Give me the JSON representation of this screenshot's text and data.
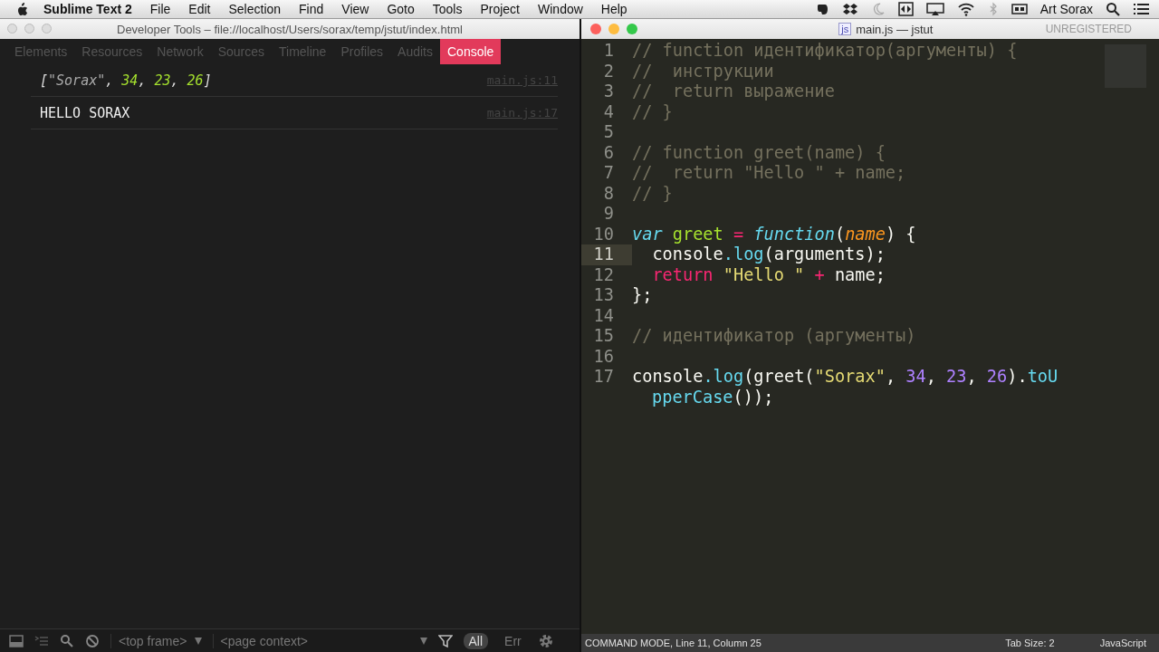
{
  "menubar": {
    "app": "Sublime Text 2",
    "items": [
      "File",
      "Edit",
      "Selection",
      "Find",
      "View",
      "Goto",
      "Tools",
      "Project",
      "Window",
      "Help"
    ],
    "user": "Art Sorax"
  },
  "devtools": {
    "title": "Developer Tools – file://localhost/Users/sorax/temp/jstut/index.html",
    "tabs": [
      {
        "label": "Elements",
        "selected": false
      },
      {
        "label": "Resources",
        "selected": false
      },
      {
        "label": "Network",
        "selected": false
      },
      {
        "label": "Sources",
        "selected": false
      },
      {
        "label": "Timeline",
        "selected": false
      },
      {
        "label": "Profiles",
        "selected": false
      },
      {
        "label": "Audits",
        "selected": false
      },
      {
        "label": "Console",
        "selected": true
      }
    ],
    "console": [
      {
        "kind": "array",
        "tokens": [
          {
            "kind": "plain",
            "text": "["
          },
          {
            "kind": "string",
            "text": "\"Sorax\""
          },
          {
            "kind": "plain",
            "text": ", "
          },
          {
            "kind": "number",
            "text": "34"
          },
          {
            "kind": "plain",
            "text": ", "
          },
          {
            "kind": "number",
            "text": "23"
          },
          {
            "kind": "plain",
            "text": ", "
          },
          {
            "kind": "number",
            "text": "26"
          },
          {
            "kind": "plain",
            "text": "]"
          }
        ],
        "source": "main.js:11"
      },
      {
        "kind": "text",
        "tokens": [
          {
            "kind": "plain",
            "text": "HELLO SORAX"
          }
        ],
        "source": "main.js:17"
      }
    ],
    "toolbar": {
      "frame": "<top frame>",
      "context": "<page context>",
      "filters": [
        {
          "label": "All",
          "selected": true
        },
        {
          "label": "Err",
          "selected": false
        }
      ]
    }
  },
  "editor": {
    "title": "main.js — jstut",
    "badge": "js",
    "registration": "UNREGISTERED",
    "lines": [
      {
        "number": "1",
        "current": false,
        "tokens": [
          {
            "kind": "comment",
            "text": "// function идентификатор(аргументы) {"
          }
        ]
      },
      {
        "number": "2",
        "current": false,
        "tokens": [
          {
            "kind": "comment",
            "text": "//  инструкции"
          }
        ]
      },
      {
        "number": "3",
        "current": false,
        "tokens": [
          {
            "kind": "comment",
            "text": "//  return выражение"
          }
        ]
      },
      {
        "number": "4",
        "current": false,
        "tokens": [
          {
            "kind": "comment",
            "text": "// }"
          }
        ]
      },
      {
        "number": "5",
        "current": false
      },
      {
        "number": "6",
        "current": false,
        "tokens": [
          {
            "kind": "comment",
            "text": "// function greet(name) {"
          }
        ]
      },
      {
        "number": "7",
        "current": false,
        "tokens": [
          {
            "kind": "comment",
            "text": "//  return \"Hello \" + name;"
          }
        ]
      },
      {
        "number": "8",
        "current": false,
        "tokens": [
          {
            "kind": "comment",
            "text": "// }"
          }
        ]
      },
      {
        "number": "9",
        "current": false
      },
      {
        "number": "10",
        "current": false,
        "tokens": [
          {
            "kind": "storage",
            "text": "var"
          },
          {
            "kind": "entity",
            "text": " greet"
          },
          {
            "kind": "keyword",
            "text": " = "
          },
          {
            "kind": "storage",
            "text": "function"
          },
          {
            "kind": "plain",
            "text": "("
          },
          {
            "kind": "param",
            "text": "name"
          },
          {
            "kind": "plain",
            "text": ") {"
          }
        ]
      },
      {
        "number": "11",
        "current": true,
        "tokens": [
          {
            "kind": "plain",
            "text": "  console"
          },
          {
            "kind": "support",
            "text": ".log"
          },
          {
            "kind": "plain",
            "text": "(arguments);"
          }
        ]
      },
      {
        "number": "12",
        "current": false,
        "tokens": [
          {
            "kind": "keyword",
            "text": "  return"
          },
          {
            "kind": "string",
            "text": " \"Hello \""
          },
          {
            "kind": "keyword",
            "text": " +"
          },
          {
            "kind": "plain",
            "text": " name;"
          }
        ]
      },
      {
        "number": "13",
        "current": false,
        "tokens": [
          {
            "kind": "plain",
            "text": "};"
          }
        ]
      },
      {
        "number": "14",
        "current": false
      },
      {
        "number": "15",
        "current": false,
        "tokens": [
          {
            "kind": "comment",
            "text": "// идентификатор (аргументы)"
          }
        ]
      },
      {
        "number": "16",
        "current": false
      },
      {
        "number": "17",
        "current": false,
        "tokens": [
          {
            "kind": "plain",
            "text": "console"
          },
          {
            "kind": "support",
            "text": ".log"
          },
          {
            "kind": "plain",
            "text": "(greet("
          },
          {
            "kind": "string",
            "text": "\"Sorax\""
          },
          {
            "kind": "plain",
            "text": ", "
          },
          {
            "kind": "number",
            "text": "34"
          },
          {
            "kind": "plain",
            "text": ", "
          },
          {
            "kind": "number",
            "text": "23"
          },
          {
            "kind": "plain",
            "text": ", "
          },
          {
            "kind": "number",
            "text": "26"
          },
          {
            "kind": "plain",
            "text": ")."
          },
          {
            "kind": "support",
            "text": "toU"
          }
        ],
        "wrap": [
          {
            "kind": "support",
            "text": "pperCase"
          },
          {
            "kind": "plain",
            "text": "());"
          }
        ]
      }
    ],
    "status": {
      "mode": "COMMAND MODE, Line 11, Column 25",
      "tab_size": "Tab Size: 2",
      "syntax": "JavaScript"
    }
  }
}
